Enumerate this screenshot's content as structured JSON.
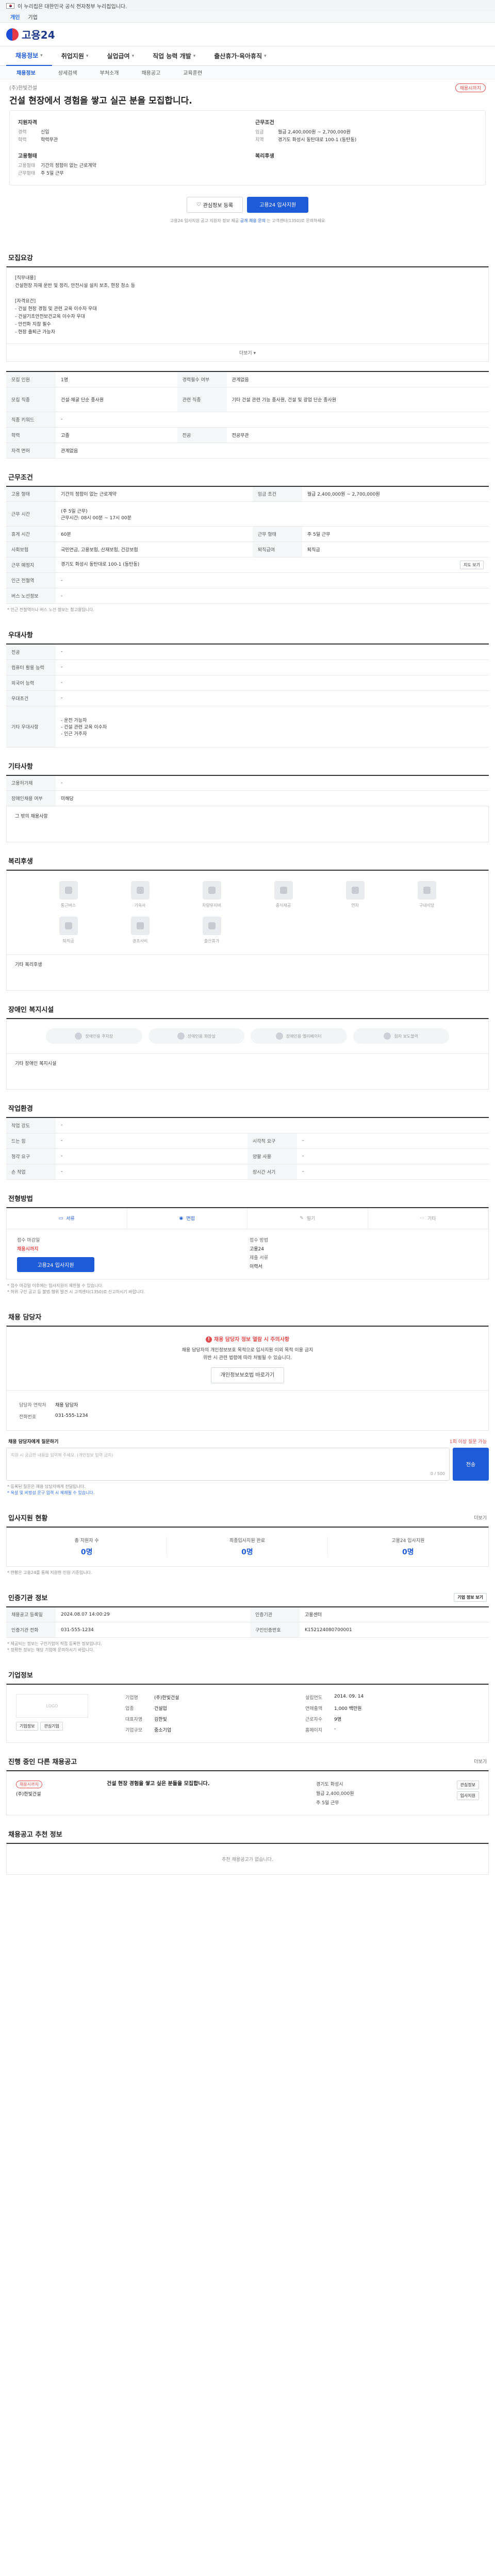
{
  "gov_banner": {
    "text": "이 누리집은 대한민국 공식 전자정부 누리집입니다.",
    "link": ""
  },
  "topbar": {
    "items": [
      "개인",
      "기업"
    ]
  },
  "logo": {
    "text": "고용24"
  },
  "nav": {
    "items": [
      "채용정보",
      "취업지원",
      "실업급여",
      "직업 능력 개발",
      "출산휴가·육아휴직"
    ]
  },
  "sub_nav": {
    "items": [
      "채용정보",
      "상세검색",
      "부처소개",
      "채용공고",
      "교육훈련"
    ]
  },
  "job": {
    "company": "(주)한빛건설",
    "badge": "채용시까지",
    "title": "건설 현장에서 경험을 쌓고 실곤 분을 모집합니다.",
    "left_title": "지원자격",
    "left_rows": [
      [
        "경력",
        "신입"
      ],
      [
        "학력",
        "학력무관"
      ]
    ],
    "left_title2": "고용형태",
    "left_rows2": [
      [
        "고용형태",
        "기간의 정함이 없는 근로계약"
      ],
      [
        "근무형태",
        "주 5일 근무"
      ]
    ],
    "right_title": "근무조건",
    "right_rows": [
      [
        "임금",
        "월급 2,400,000원 ~ 2,700,000원"
      ],
      [
        "지역",
        "경기도 화성시 동탄대로 100-1 (동탄동)"
      ]
    ],
    "right_title2": "복리후생",
    "right_rows2": []
  },
  "apply": {
    "scrap": "관심정보 등록",
    "apply_btn": "고용24 입사지원",
    "note_pre": "고용24 입사지원 공고 지원자 정보 제공",
    "note_link": "공개 채용 문의",
    "note_post": "는 고객센터(1350)로 문의하세요"
  },
  "detail": {
    "title": "모집요강",
    "desc": [
      "[직무내용]",
      "건설현장 자재 운반 및 정리, 안전시설 설치 보조, 현장 청소 등",
      "",
      "[자격요건]",
      "- 건설 현장 경험 및 관련 교육 이수자 우대",
      "- 건설기초안전보건교육 이수자 우대",
      "- 안전화 지참 필수",
      "- 현장 출퇴근 가능자"
    ],
    "more": "더보기",
    "rows": [
      [
        [
          "모집 인원",
          "1명"
        ],
        [
          "경력필수 여부",
          "관계없음"
        ]
      ],
      [
        [
          "모집 직종",
          "건설·채굴 단순 종사원"
        ],
        [
          "관련 직종",
          "기타 건설 관련 기능 종사원, 건설 및 광업 단순 종사원"
        ]
      ],
      [
        [
          "직종 키워드",
          "-"
        ],
        [
          "",
          ""
        ]
      ],
      [
        [
          "학력",
          "고졸"
        ],
        [
          "전공",
          "전공무관"
        ]
      ],
      [
        [
          "자격 면허",
          "관계없음"
        ],
        [
          "",
          ""
        ]
      ]
    ]
  },
  "conditions": {
    "title": "근무조건",
    "rows": [
      [
        [
          "고용 형태",
          "기간의 정함이 없는 근로계약"
        ],
        [
          "임금 조건",
          "월급 2,400,000원 ~ 2,700,000원"
        ]
      ],
      [
        [
          "근무 시간",
          "(주 5일 근무)\n근무시간: 08시 00분 ~ 17시 00분"
        ],
        [
          "",
          ""
        ]
      ],
      [
        [
          "휴게 시간",
          "60분"
        ],
        [
          "근무 형태",
          "주 5일 근무"
        ]
      ],
      [
        [
          "사회보험",
          "국민연금, 고용보험, 산재보험, 건강보험"
        ],
        [
          "퇴직급여",
          "퇴직금"
        ]
      ],
      [
        [
          "근무 예정지",
          "경기도 화성시 동탄대로 100-1 (동탄동)"
        ],
        [
          "",
          ""
        ]
      ],
      [
        [
          "인근 전철역",
          "-"
        ],
        [
          "",
          ""
        ]
      ],
      [
        [
          "버스 노선정보",
          "-"
        ],
        [
          "",
          ""
        ]
      ]
    ],
    "map_btn": "지도 보기",
    "note": "* 인근 전철역이나 버스 노선 정보는 참고용입니다."
  },
  "preference": {
    "title": "우대사항",
    "rows": [
      [
        "전공",
        "-"
      ],
      [
        "컴퓨터 활용 능력",
        "-"
      ],
      [
        "외국어 능력",
        "-"
      ],
      [
        "우대조건",
        "-"
      ],
      [
        "기타 우대사항",
        "- 운전 가능자\n- 건설 관련 교육 이수자\n- 인근 거주자"
      ]
    ]
  },
  "etc": {
    "title": "기타사항",
    "rows": [
      [
        "고용허가제",
        "-"
      ],
      [
        "장애인채용 여부",
        "미해당"
      ]
    ],
    "sub": "그 밖의 채용사항"
  },
  "welfare": {
    "title": "복리후생",
    "items": [
      "통근버스",
      "기숙사",
      "차량유지비",
      "중식제공",
      "연차",
      "구내식당",
      "퇴직금",
      "경조사비",
      "출산휴가"
    ],
    "sub": "기타 복리후생"
  },
  "disability": {
    "title": "장애인 복지시설",
    "items": [
      "장애인용 주차장",
      "장애인용 화장실",
      "장애인용 엘리베이터",
      "점자 보도블럭"
    ],
    "sub": "기타 장애인 복지시설"
  },
  "work_env": {
    "title": "작업환경",
    "rows": [
      [
        [
          "작업 강도",
          "-"
        ],
        [
          "",
          ""
        ]
      ],
      [
        [
          "드는 힘",
          "-"
        ],
        [
          "시각적 요구",
          "-"
        ]
      ],
      [
        [
          "청각 요구",
          "-"
        ],
        [
          "양팔 사용",
          "-"
        ]
      ],
      [
        [
          "손 작업",
          "-"
        ],
        [
          "장시간 서기",
          "-"
        ]
      ]
    ]
  },
  "method": {
    "title": "전형방법",
    "tabs": [
      "서류",
      "면접",
      "필기",
      "기타"
    ],
    "left_k": "접수 마감일",
    "left_v": "채용시까지",
    "left_btn": "고용24 입사지원",
    "right_k": "접수 방법",
    "right_v": "고용24",
    "right_k2": "제출 서류",
    "right_v2": "이력서",
    "notes": [
      "* 접수 마감일 이후에는 입사지원이 제한될 수 있습니다.",
      "* 허위 구인 공고 등 불법 행위 발견 시 고객센터(1350)로 신고하시기 바랍니다."
    ]
  },
  "manager": {
    "title": "채용 담당자",
    "warn_title": "채용 담당자 정보 열람 시 주의사항",
    "warn_lines": [
      "채용 담당자의 개인정보보호 목적으로 입사지원 이외 목적 이용 금지",
      "위반 시 관련 법령에 따라 처벌될 수 있습니다."
    ],
    "warn_btn": "개인정보보호법 바로가기",
    "contact_k": [
      "담당자 연락처",
      "전화번호"
    ],
    "contact_v": [
      "채용 담당자",
      "031-555-1234"
    ],
    "qa_k": "채용 담당자에게 질문하기",
    "qa_r": "1회 이상 질문 가능",
    "qa_placeholder": "지원 시 궁금한 내용을 입력해 주세요. (개인정보 입력 금지)",
    "qa_count": "0 / 500",
    "qa_btn": "전송",
    "qa_notes": [
      "* 등록된 질문은 채용 담당자에게 전달됩니다.",
      "* 욕설 및 비방성 문구 입력 시 제재될 수 있습니다."
    ]
  },
  "status": {
    "title": "입사지원 현황",
    "more": "더보기",
    "cells": [
      [
        "총 지원자 수",
        "0명"
      ],
      [
        "최종입사지원 완료",
        "0명"
      ],
      [
        "고용24 입사지원",
        "0명"
      ]
    ],
    "note": "* 현황은 고용24를 통해 지원한 인원 기준입니다."
  },
  "source": {
    "title": "인증기관 정보",
    "more": "기업 정보 보기",
    "rows": [
      [
        [
          "채용공고 등록일",
          "2024.08.07 14:00:29"
        ],
        [
          "인증기관",
          "고용센터"
        ]
      ],
      [
        [
          "인증기관 전화",
          "031-555-1234"
        ],
        [
          "구인인증번호",
          "K152124080700001"
        ]
      ]
    ],
    "notes": [
      "* 제공되는 정보는 구인기업이 직접 등록한 정보입니다.",
      "* 정확한 정보는 해당 기업에 문의하시기 바랍니다."
    ]
  },
  "company": {
    "title": "기업정보",
    "logo": "LOGO",
    "btns": [
      "기업정보",
      "관심기업"
    ],
    "kv1": [
      [
        "기업명",
        "(주)한빛건설"
      ],
      [
        "업종",
        "건설업"
      ],
      [
        "대표자명",
        "김한빛"
      ],
      [
        "기업규모",
        "중소기업"
      ]
    ],
    "kv2": [
      [
        "설립연도",
        "2014. 09. 14"
      ],
      [
        "연매출액",
        "1,000 백만원"
      ],
      [
        "근로자수",
        "9명"
      ],
      [
        "홈페이지",
        "-"
      ]
    ]
  },
  "hiring": {
    "title": "진행 중인 다른 채용공고",
    "more": "더보기",
    "badge": "채용시까지",
    "company": "(주)한빛건설",
    "job_title": "건설 현장 경험을 쌓고 싶은 분들을 모집합니다.",
    "meta": [
      "경기도 화성시",
      "월급 2,400,000원",
      "주 5일 근무"
    ],
    "side": [
      "관심정보",
      "입사지원"
    ]
  },
  "recommend": {
    "title": "채용공고 추천 정보",
    "text": "추천 채용공고가 없습니다."
  }
}
